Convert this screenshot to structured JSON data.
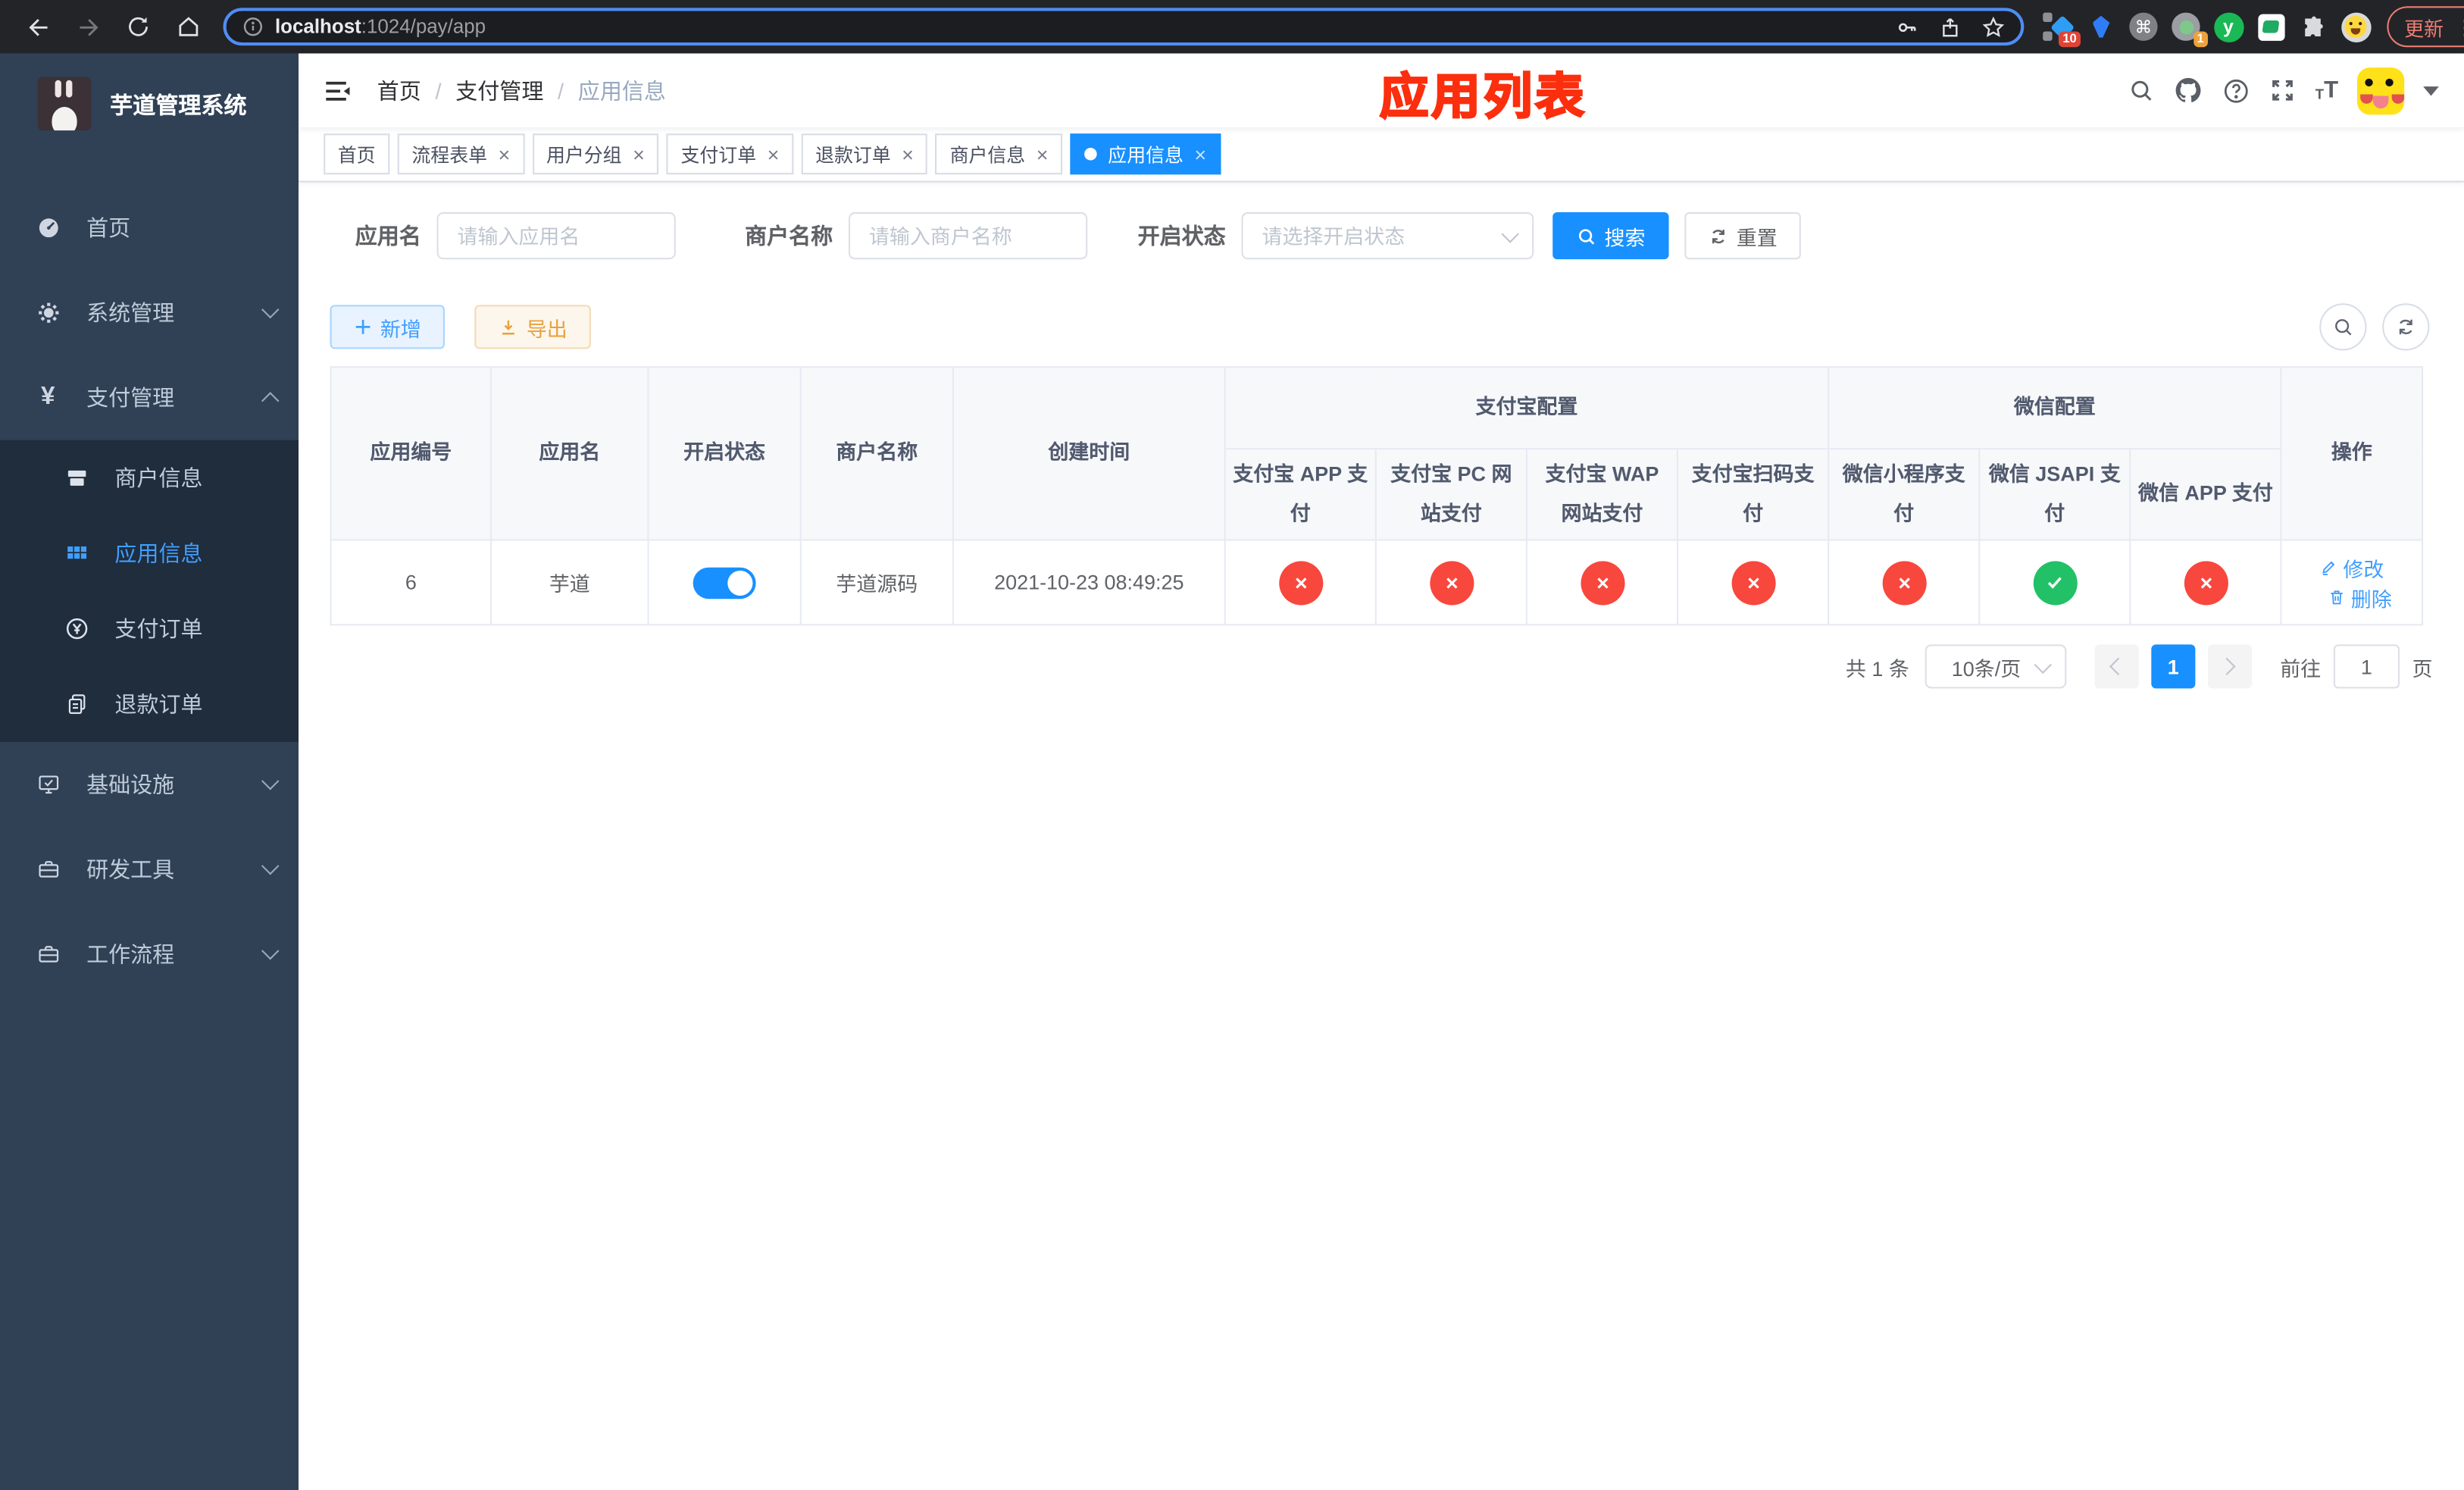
{
  "browser": {
    "url_host": "localhost",
    "url_rest": ":1024/pay/app",
    "update_label": "更新",
    "ext_badge_blue": "10",
    "ext_badge_circle": "1"
  },
  "sidebar": {
    "title": "芋道管理系统",
    "items": [
      {
        "label": "首页"
      },
      {
        "label": "系统管理"
      },
      {
        "label": "支付管理",
        "children": [
          {
            "label": "商户信息"
          },
          {
            "label": "应用信息"
          },
          {
            "label": "支付订单"
          },
          {
            "label": "退款订单"
          }
        ]
      },
      {
        "label": "基础设施"
      },
      {
        "label": "研发工具"
      },
      {
        "label": "工作流程"
      }
    ]
  },
  "navbar": {
    "breadcrumb": [
      "首页",
      "支付管理",
      "应用信息"
    ],
    "annotation": "应用列表"
  },
  "tabs": [
    {
      "label": "首页",
      "closable": false,
      "active": false
    },
    {
      "label": "流程表单",
      "closable": true,
      "active": false
    },
    {
      "label": "用户分组",
      "closable": true,
      "active": false
    },
    {
      "label": "支付订单",
      "closable": true,
      "active": false
    },
    {
      "label": "退款订单",
      "closable": true,
      "active": false
    },
    {
      "label": "商户信息",
      "closable": true,
      "active": false
    },
    {
      "label": "应用信息",
      "closable": true,
      "active": true
    }
  ],
  "filters": {
    "app_name_label": "应用名",
    "app_name_placeholder": "请输入应用名",
    "merchant_label": "商户名称",
    "merchant_placeholder": "请输入商户名称",
    "status_label": "开启状态",
    "status_placeholder": "请选择开启状态",
    "search_label": "搜索",
    "reset_label": "重置"
  },
  "toolbar": {
    "add_label": "新增",
    "export_label": "导出"
  },
  "table": {
    "leaf_headers": [
      "应用编号",
      "应用名",
      "开启状态",
      "商户名称",
      "创建时间"
    ],
    "group_headers": [
      "支付宝配置",
      "微信配置"
    ],
    "sub_headers": [
      "支付宝 APP 支付",
      "支付宝 PC 网站支付",
      "支付宝 WAP 网站支付",
      "支付宝扫码支付",
      "微信小程序支付",
      "微信 JSAPI 支付",
      "微信 APP 支付"
    ],
    "op_header": "操作",
    "row": {
      "id": "6",
      "name": "芋道",
      "enabled": true,
      "merchant": "芋道源码",
      "created": "2021-10-23 08:49:25",
      "channel_status": [
        "no",
        "no",
        "no",
        "no",
        "no",
        "yes",
        "no"
      ],
      "edit_label": "修改",
      "delete_label": "删除"
    }
  },
  "pagination": {
    "total": "共 1 条",
    "page_size": "10条/页",
    "page": "1",
    "goto_label": "前往",
    "goto_value": "1",
    "unit_label": "页"
  },
  "colors": {
    "accent": "#1890ff",
    "link": "#409eff",
    "danger": "#f8473d",
    "success": "#22c168",
    "warning": "#e6a23c",
    "annotation": "#fb2e0d",
    "sidebar_bg": "#304156",
    "submenu_bg": "#1f2d3d"
  }
}
